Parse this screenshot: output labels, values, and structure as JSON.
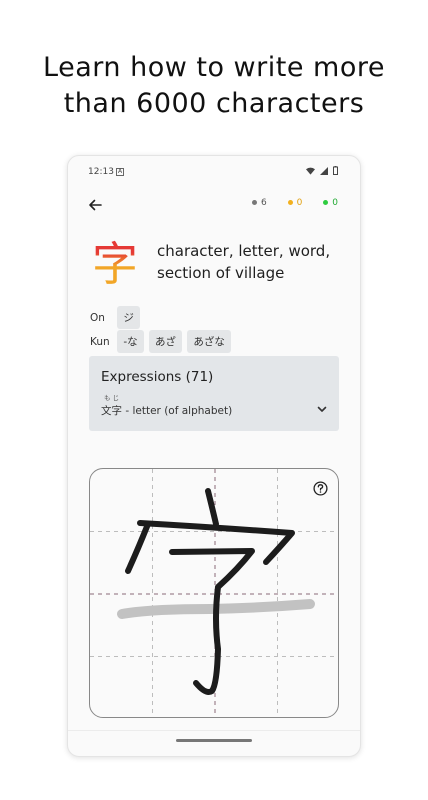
{
  "headline": {
    "line1": "Learn how to write more",
    "line2": "than 6000 characters"
  },
  "statusbar": {
    "time": "12:13",
    "icons": [
      "wifi-icon",
      "signal-icon",
      "battery-icon"
    ]
  },
  "counters": [
    {
      "value": "6",
      "color": "#777777"
    },
    {
      "value": "0",
      "color": "#f2b01e"
    },
    {
      "value": "0",
      "color": "#2ecc40"
    }
  ],
  "kanji": {
    "character": "字",
    "meaning": "character, letter, word, section of village"
  },
  "readings": {
    "on_label": "On",
    "on": [
      "ジ"
    ],
    "kun_label": "Kun",
    "kun": [
      "-な",
      "あざ",
      "あざな"
    ]
  },
  "expressions": {
    "title": "Expressions (71)",
    "furigana": "もじ",
    "item": "文字 - letter (of alphabet)"
  },
  "colors": {
    "accent_red": "#e53935",
    "accent_orange": "#f2a627",
    "panel": "#e3e6e9"
  }
}
